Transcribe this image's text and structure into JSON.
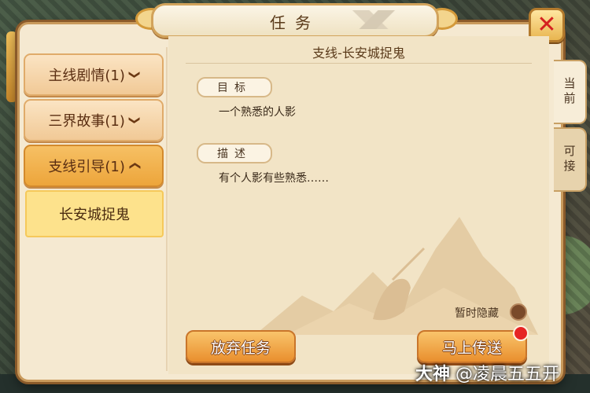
{
  "dialog": {
    "title": "任务",
    "close_icon": "close-x-icon"
  },
  "categories": [
    {
      "label": "主线剧情(1)",
      "chevron": "❯",
      "expanded": false
    },
    {
      "label": "三界故事(1)",
      "chevron": "❯",
      "expanded": false
    },
    {
      "label": "支线引导(1)",
      "chevron": "❯",
      "expanded": true
    }
  ],
  "selected_quest_item": "长安城捉鬼",
  "quest": {
    "title": "支线-长安城捉鬼",
    "goal_label": "目标",
    "goal_text": "一个熟悉的人影",
    "desc_label": "描述",
    "desc_text": "有个人影有些熟悉……"
  },
  "hide_label": "暂时隐藏",
  "buttons": {
    "abandon": "放弃任务",
    "teleport": "马上传送"
  },
  "side_tabs": {
    "current": "当前",
    "available": "可接"
  },
  "watermark": {
    "brand": "大神",
    "user": "@凌晨五五开"
  },
  "colors": {
    "accent": "#eda53b",
    "close_x": "#d42020",
    "notify_dot": "#e62424"
  }
}
